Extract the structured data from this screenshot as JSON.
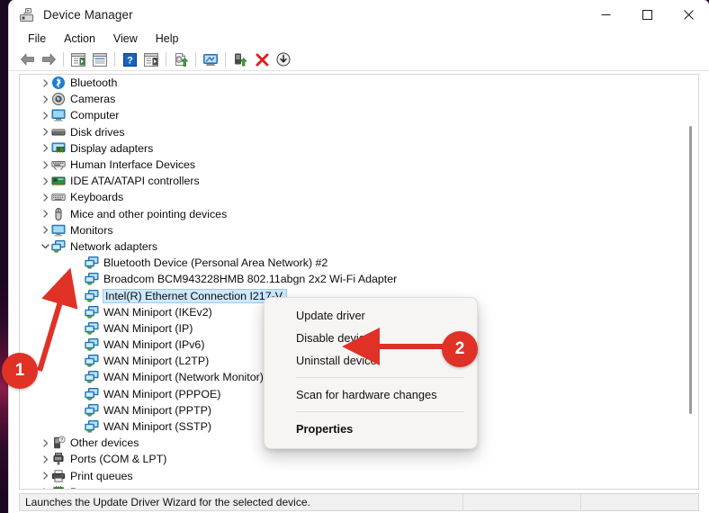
{
  "window": {
    "title": "Device Manager",
    "app_icon": "device-manager-icon",
    "controls": {
      "minimize": "—",
      "maximize": "□",
      "close": "✕"
    }
  },
  "menubar": {
    "items": [
      {
        "label": "File"
      },
      {
        "label": "Action"
      },
      {
        "label": "View"
      },
      {
        "label": "Help"
      }
    ]
  },
  "toolbar": {
    "buttons": [
      {
        "name": "back-icon"
      },
      {
        "name": "forward-icon"
      },
      {
        "name": "show-hide-console-tree-icon"
      },
      {
        "name": "properties-icon"
      },
      {
        "name": "help-icon"
      },
      {
        "name": "show-hide-action-pane-icon"
      },
      {
        "name": "update-driver-icon"
      },
      {
        "name": "scan-for-hardware-changes-icon"
      },
      {
        "name": "enable-device-icon"
      },
      {
        "name": "uninstall-device-icon"
      },
      {
        "name": "disable-device-icon"
      }
    ]
  },
  "tree": {
    "nodes": [
      {
        "label": "Bluetooth",
        "icon": "bluetooth-icon",
        "level": 0,
        "expandable": true,
        "expanded": false,
        "selected": false
      },
      {
        "label": "Cameras",
        "icon": "camera-icon",
        "level": 0,
        "expandable": true,
        "expanded": false,
        "selected": false
      },
      {
        "label": "Computer",
        "icon": "computer-icon",
        "level": 0,
        "expandable": true,
        "expanded": false,
        "selected": false
      },
      {
        "label": "Disk drives",
        "icon": "disk-drive-icon",
        "level": 0,
        "expandable": true,
        "expanded": false,
        "selected": false
      },
      {
        "label": "Display adapters",
        "icon": "display-adapter-icon",
        "level": 0,
        "expandable": true,
        "expanded": false,
        "selected": false
      },
      {
        "label": "Human Interface Devices",
        "icon": "hid-icon",
        "level": 0,
        "expandable": true,
        "expanded": false,
        "selected": false
      },
      {
        "label": "IDE ATA/ATAPI controllers",
        "icon": "ide-controller-icon",
        "level": 0,
        "expandable": true,
        "expanded": false,
        "selected": false
      },
      {
        "label": "Keyboards",
        "icon": "keyboard-icon",
        "level": 0,
        "expandable": true,
        "expanded": false,
        "selected": false
      },
      {
        "label": "Mice and other pointing devices",
        "icon": "mouse-icon",
        "level": 0,
        "expandable": true,
        "expanded": false,
        "selected": false
      },
      {
        "label": "Monitors",
        "icon": "monitor-icon",
        "level": 0,
        "expandable": true,
        "expanded": false,
        "selected": false
      },
      {
        "label": "Network adapters",
        "icon": "network-adapter-icon",
        "level": 0,
        "expandable": true,
        "expanded": true,
        "selected": false
      },
      {
        "label": "Bluetooth Device (Personal Area Network) #2",
        "icon": "network-adapter-icon",
        "level": 1,
        "expandable": false,
        "expanded": false,
        "selected": false
      },
      {
        "label": "Broadcom BCM943228HMB 802.11abgn 2x2 Wi-Fi Adapter",
        "icon": "network-adapter-icon",
        "level": 1,
        "expandable": false,
        "expanded": false,
        "selected": false
      },
      {
        "label": "Intel(R) Ethernet Connection I217-V",
        "icon": "network-adapter-icon",
        "level": 1,
        "expandable": false,
        "expanded": false,
        "selected": true
      },
      {
        "label": "WAN Miniport (IKEv2)",
        "icon": "network-adapter-icon",
        "level": 1,
        "expandable": false,
        "expanded": false,
        "selected": false
      },
      {
        "label": "WAN Miniport (IP)",
        "icon": "network-adapter-icon",
        "level": 1,
        "expandable": false,
        "expanded": false,
        "selected": false
      },
      {
        "label": "WAN Miniport (IPv6)",
        "icon": "network-adapter-icon",
        "level": 1,
        "expandable": false,
        "expanded": false,
        "selected": false
      },
      {
        "label": "WAN Miniport (L2TP)",
        "icon": "network-adapter-icon",
        "level": 1,
        "expandable": false,
        "expanded": false,
        "selected": false
      },
      {
        "label": "WAN Miniport (Network Monitor)",
        "icon": "network-adapter-icon",
        "level": 1,
        "expandable": false,
        "expanded": false,
        "selected": false
      },
      {
        "label": "WAN Miniport (PPPOE)",
        "icon": "network-adapter-icon",
        "level": 1,
        "expandable": false,
        "expanded": false,
        "selected": false
      },
      {
        "label": "WAN Miniport (PPTP)",
        "icon": "network-adapter-icon",
        "level": 1,
        "expandable": false,
        "expanded": false,
        "selected": false
      },
      {
        "label": "WAN Miniport (SSTP)",
        "icon": "network-adapter-icon",
        "level": 1,
        "expandable": false,
        "expanded": false,
        "selected": false
      },
      {
        "label": "Other devices",
        "icon": "other-device-icon",
        "level": 0,
        "expandable": true,
        "expanded": false,
        "selected": false
      },
      {
        "label": "Ports (COM & LPT)",
        "icon": "port-icon",
        "level": 0,
        "expandable": true,
        "expanded": false,
        "selected": false
      },
      {
        "label": "Print queues",
        "icon": "printer-icon",
        "level": 0,
        "expandable": true,
        "expanded": false,
        "selected": false
      },
      {
        "label": "Processors",
        "icon": "processor-icon",
        "level": 0,
        "expandable": true,
        "expanded": false,
        "selected": false
      }
    ]
  },
  "context_menu": {
    "items": [
      {
        "label": "Update driver",
        "bold": false,
        "separator_after": false
      },
      {
        "label": "Disable device",
        "bold": false,
        "separator_after": false
      },
      {
        "label": "Uninstall device",
        "bold": false,
        "separator_after": true
      },
      {
        "label": "Scan for hardware changes",
        "bold": false,
        "separator_after": true
      },
      {
        "label": "Properties",
        "bold": true,
        "separator_after": false
      }
    ]
  },
  "statusbar": {
    "text": "Launches the Update Driver Wizard for the selected device."
  },
  "annotations": {
    "markers": [
      {
        "id": "1",
        "label": "1",
        "target": "Intel(R) Ethernet Connection I217-V"
      },
      {
        "id": "2",
        "label": "2",
        "target": "Uninstall device"
      }
    ],
    "color": "#e03127"
  }
}
